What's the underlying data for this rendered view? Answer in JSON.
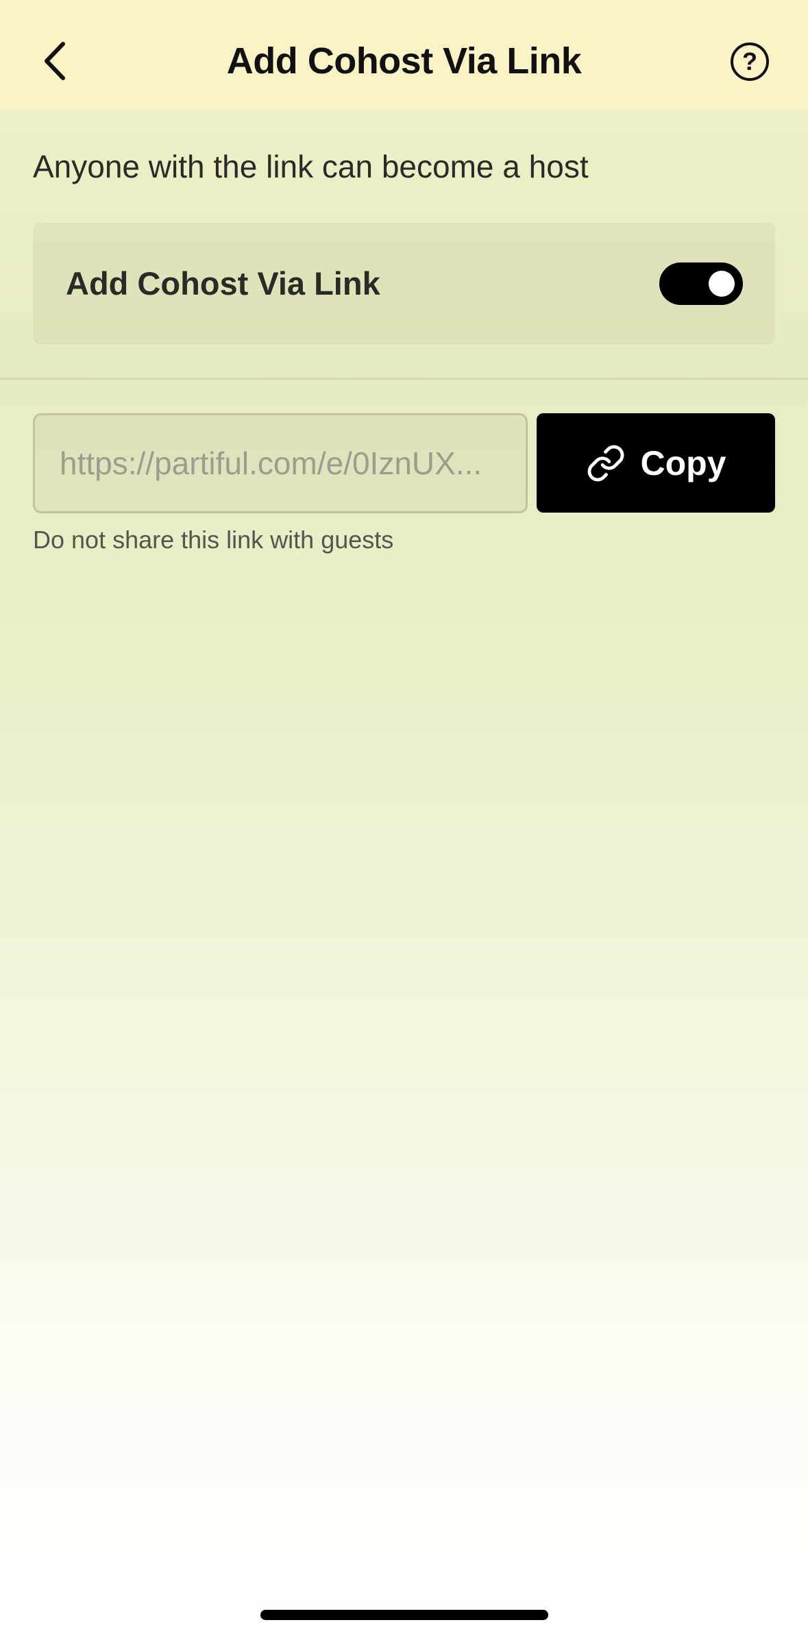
{
  "header": {
    "title": "Add Cohost Via Link",
    "back_icon": "chevron-left-icon",
    "help_icon": "help-circle-icon",
    "help_glyph": "?"
  },
  "description": "Anyone with the link can become a host",
  "toggle_setting": {
    "label": "Add Cohost Via Link",
    "enabled": true
  },
  "link": {
    "value": "https://partiful.com/e/0IznUX...",
    "copy_label": "Copy",
    "copy_icon": "link-icon",
    "helper": "Do not share this link with guests"
  },
  "colors": {
    "header_bg": "#fbf3c6",
    "accent": "#000000",
    "background_top": "#eef0c8",
    "background_bottom": "#ffffff"
  }
}
